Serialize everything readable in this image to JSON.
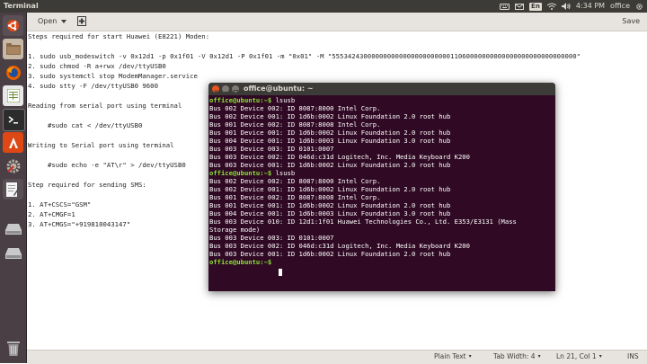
{
  "top_panel": {
    "window_title": "Terminal",
    "input_language": "En",
    "clock": "4:34 PM",
    "user": "office",
    "icons": [
      "keyboard-icon",
      "mail-icon",
      "wifi-icon",
      "volume-icon",
      "settings-gear-icon"
    ]
  },
  "launcher": {
    "items": [
      "dash-home-icon",
      "files-icon",
      "firefox-icon",
      "libreoffice-calc-icon",
      "terminal-icon",
      "app-store-icon",
      "system-settings-icon",
      "text-editor-icon",
      "drive-icon",
      "drive-icon",
      "trash-icon"
    ]
  },
  "gedit": {
    "open_label": "Open",
    "save_label": "Save",
    "lines": [
      "Steps required for start Huawei (E8221) Moden:",
      "",
      "1. sudo usb_modeswitch -v 0x12d1 -p 0x1f01 -V 0x12d1 -P 0x1f01 -m \"0x01\" -M \"55534243000000000000000000000011060000000000000000000000000000\"",
      "2. sudo chmod -R a+rwx /dev/ttyUSB0",
      "3. sudo systemctl stop ModemManager.service",
      "4. sudo stty -F /dev/ttyUSB0 9600",
      "",
      "Reading from serial port using terminal",
      "",
      "     #sudo cat < /dev/ttyUSB0",
      "",
      "Writing to Serial port using terminal",
      "",
      "     #sudo echo -e \"AT\\r\" > /dev/ttyUSB0",
      "",
      "Step required for sending SMS:",
      "",
      "1. AT+CSCS=\"GSM\"",
      "2. AT+CMGF=1",
      "3. AT+CMGS=\"+919810043147\""
    ],
    "status": {
      "language": "Plain Text",
      "tab_width": "Tab Width: 4",
      "position": "Ln 21, Col 1",
      "mode": "INS"
    }
  },
  "terminal": {
    "title": "office@ubuntu: ~",
    "lines": [
      {
        "prompt": "office@ubuntu:~$",
        "text": " lsusb"
      },
      {
        "prompt": "",
        "text": "Bus 002 Device 002: ID 8087:8000 Intel Corp."
      },
      {
        "prompt": "",
        "text": "Bus 002 Device 001: ID 1d6b:0002 Linux Foundation 2.0 root hub"
      },
      {
        "prompt": "",
        "text": "Bus 001 Device 002: ID 8087:8008 Intel Corp."
      },
      {
        "prompt": "",
        "text": "Bus 001 Device 001: ID 1d6b:0002 Linux Foundation 2.0 root hub"
      },
      {
        "prompt": "",
        "text": "Bus 004 Device 001: ID 1d6b:0003 Linux Foundation 3.0 root hub"
      },
      {
        "prompt": "",
        "text": "Bus 003 Device 003: ID 0101:0007"
      },
      {
        "prompt": "",
        "text": "Bus 003 Device 002: ID 046d:c31d Logitech, Inc. Media Keyboard K200"
      },
      {
        "prompt": "",
        "text": "Bus 003 Device 001: ID 1d6b:0002 Linux Foundation 2.0 root hub"
      },
      {
        "prompt": "office@ubuntu:~$",
        "text": " lsusb"
      },
      {
        "prompt": "",
        "text": "Bus 002 Device 002: ID 8087:8000 Intel Corp."
      },
      {
        "prompt": "",
        "text": "Bus 002 Device 001: ID 1d6b:0002 Linux Foundation 2.0 root hub"
      },
      {
        "prompt": "",
        "text": "Bus 001 Device 002: ID 8087:8008 Intel Corp."
      },
      {
        "prompt": "",
        "text": "Bus 001 Device 001: ID 1d6b:0002 Linux Foundation 2.0 root hub"
      },
      {
        "prompt": "",
        "text": "Bus 004 Device 001: ID 1d6b:0003 Linux Foundation 3.0 root hub"
      },
      {
        "prompt": "",
        "text": "Bus 003 Device 010: ID 12d1:1f01 Huawei Technologies Co., Ltd. E353/E3131 (Mass"
      },
      {
        "prompt": "",
        "text": "Storage mode)"
      },
      {
        "prompt": "",
        "text": "Bus 003 Device 003: ID 0101:0007"
      },
      {
        "prompt": "",
        "text": "Bus 003 Device 002: ID 046d:c31d Logitech, Inc. Media Keyboard K200"
      },
      {
        "prompt": "",
        "text": "Bus 003 Device 001: ID 1d6b:0002 Linux Foundation 2.0 root hub"
      },
      {
        "prompt": "office@ubuntu:~$",
        "text": ""
      }
    ]
  },
  "colors": {
    "panel": "#3c3b37",
    "launcher": "#4a3f45",
    "terminal_bg": "#300a24",
    "prompt": "#8ae234",
    "close_button": "#e95420"
  }
}
